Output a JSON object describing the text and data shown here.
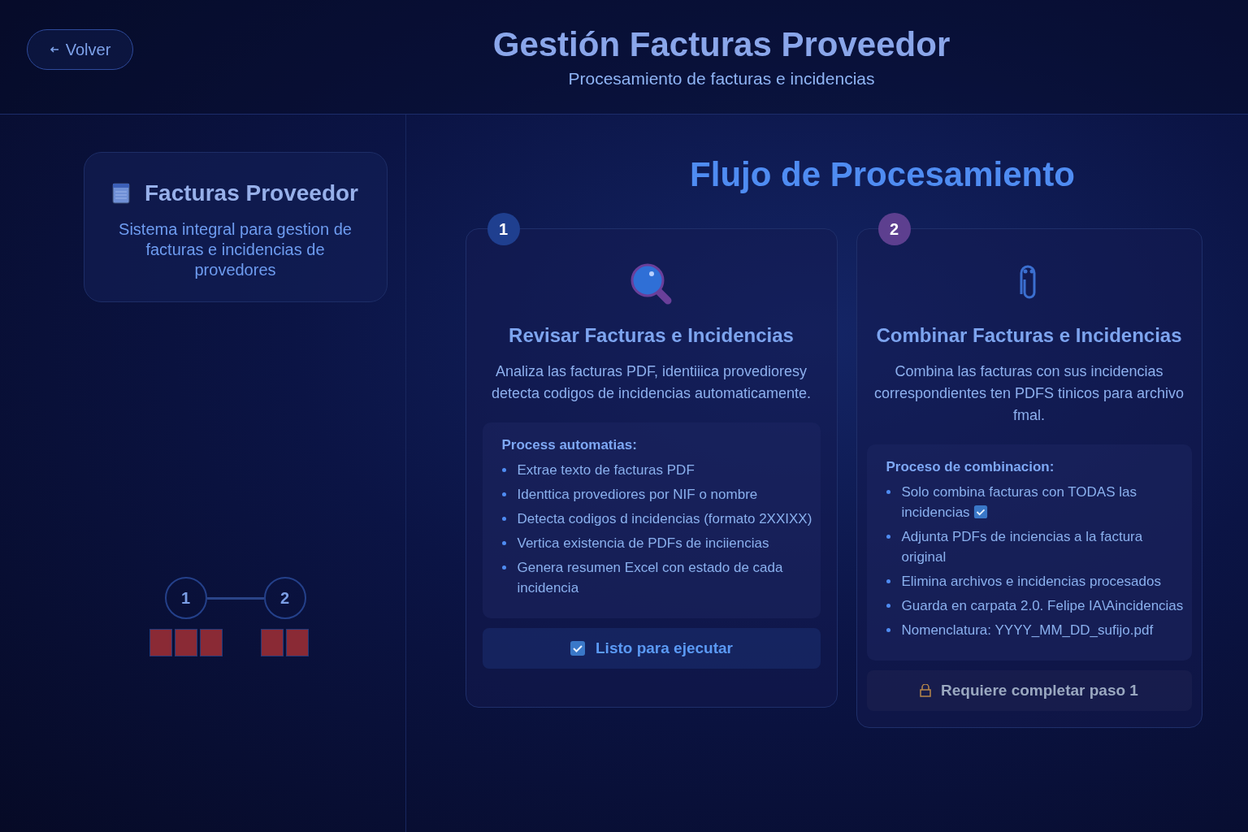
{
  "header": {
    "back_button": "Volver",
    "title": "Gestión Facturas Proveedor",
    "subtitle": "Procesamiento de facturas e incidencias"
  },
  "sidebar": {
    "card": {
      "title": "Facturas Proveedor",
      "description": "Sistema integral para gestion de facturas e incidencias de provedores"
    },
    "steps": [
      {
        "number": "1",
        "tasks": [
          {
            "done": false
          },
          {
            "done": false
          },
          {
            "done": false
          }
        ]
      },
      {
        "number": "2",
        "tasks": [
          {
            "done": false
          },
          {
            "done": false
          }
        ]
      }
    ]
  },
  "main": {
    "title": "Flujo de Procesamiento",
    "cards": [
      {
        "number": "1",
        "color": "#1f3f8f",
        "title": "Revisar Facturas e Incidencias",
        "description": "Analiza las facturas PDF, identiiica provedioresy detecta codigos de incidencias automaticamente.",
        "list_title": "Process automatias:",
        "items": [
          {
            "text": "Extrae texto de facturas PDF",
            "check": false
          },
          {
            "text": "Identtica provediores por NIF o nombre",
            "check": false
          },
          {
            "text": "Detecta codigos d incidencias (formato 2XXIXX)",
            "check": false
          },
          {
            "text": "Vertica existencia de PDFs de inciiencias",
            "check": false
          },
          {
            "text": "Genera resumen Excel con estado de cada incidencia",
            "check": false
          }
        ],
        "status": {
          "kind": "ready",
          "label": "Listo para ejecutar"
        }
      },
      {
        "number": "2",
        "color": "#5d3f8f",
        "title": "Combinar Facturas e Incidencias",
        "description": "Combina las facturas con sus incidencias correspondientes ten PDFS tinicos para archivo fmal.",
        "list_title": "Proceso de combinacion:",
        "items": [
          {
            "text": "Solo combina facturas con TODAS las incidencias",
            "check": true
          },
          {
            "text": "Adjunta PDFs de inciencias a la factura original",
            "check": false
          },
          {
            "text": "Elimina archivos e incidencias procesados",
            "check": false
          },
          {
            "text": "Guarda en carpata 2.0. Felipe IA\\Aincidencias",
            "check": false
          },
          {
            "text": "Nomenclatura: YYYY_MM_DD_sufijo.pdf",
            "check": false
          }
        ],
        "status": {
          "kind": "locked",
          "label": "Requiere completar paso 1"
        }
      }
    ]
  }
}
